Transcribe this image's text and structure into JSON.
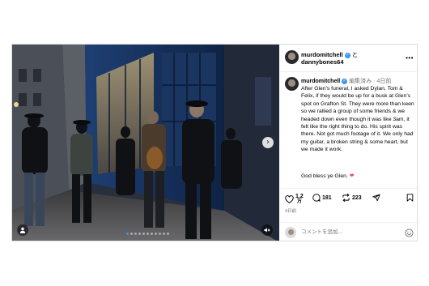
{
  "post": {
    "header": {
      "author": "murdomitchell",
      "and_text": "と",
      "coauthor": "dannybones64"
    },
    "caption": {
      "author": "murdomitchell",
      "edited": "編集済み",
      "time": "4日前",
      "text": "After Glen's funeral, I asked Dylan, Tom & Felix, if they would be up for a busk at Glen's spot on Grafton St. They were more than keen so we rallied a group of some friends & we headed down even though it was like 3am, it felt like the right thing to do. His spirit was there. Not got much footage of it. We only had my guitar, a broken string & some heart, but we made it work.",
      "sign": "God bless ye Glen. ",
      "sign_emoji": "❤"
    },
    "actions": {
      "likes_top": "1.2",
      "likes_bottom": "万",
      "comments": "181",
      "reposts": "223",
      "date": "4日前"
    },
    "comment_placeholder": "コメントを追加...",
    "carousel": {
      "slides": 11,
      "active": 0
    },
    "icons": {
      "like": "heart-icon",
      "comment": "comment-icon",
      "repost": "repost-icon",
      "share": "share-icon",
      "save": "bookmark-icon",
      "next": "chevron-right-icon",
      "user": "user-tag-icon",
      "mute": "speaker-mute-icon",
      "emoji": "emoji-icon",
      "more": "more-icon"
    },
    "colors": {
      "verified": "#3897f0",
      "heart": "#ed4956",
      "muted": "#737373"
    }
  }
}
